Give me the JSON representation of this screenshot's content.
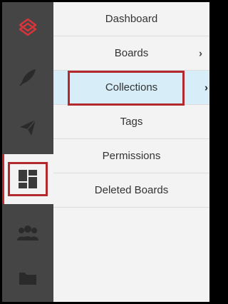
{
  "rail": {
    "items": [
      {
        "icon": "app-logo-icon"
      },
      {
        "icon": "feather-icon"
      },
      {
        "icon": "paper-plane-icon"
      },
      {
        "icon": "dashboard-grid-icon"
      },
      {
        "icon": "users-group-icon"
      },
      {
        "icon": "folder-icon"
      }
    ],
    "accent_color": "#c1272d",
    "background_color": "#454545"
  },
  "menu": {
    "items": [
      {
        "label": "Dashboard"
      },
      {
        "label": "Boards",
        "chevron": "›"
      },
      {
        "label": "Collections",
        "chevron": "›"
      },
      {
        "label": "Tags"
      },
      {
        "label": "Permissions"
      },
      {
        "label": "Deleted Boards"
      }
    ],
    "selected_color": "#d7eef9"
  },
  "highlight_color": "#b22a2e"
}
